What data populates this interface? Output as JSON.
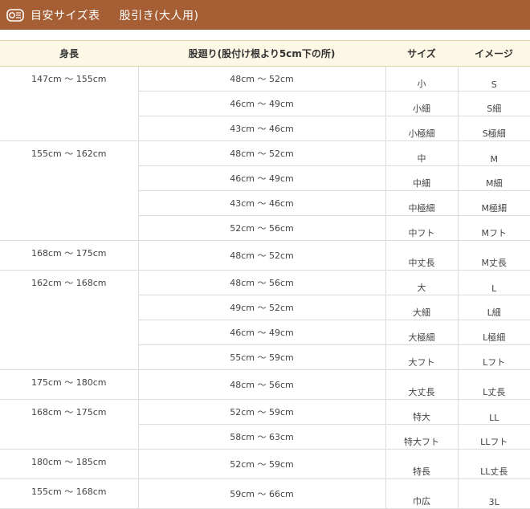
{
  "header": {
    "title": "目安サイズ表",
    "subtitle": "股引き(大人用)",
    "icon": "tape-measure-icon",
    "bg_color": "#a65e35"
  },
  "table": {
    "headers": [
      "身長",
      "股廻り(股付け根より5cm下の所)",
      "サイズ",
      "イメージ"
    ],
    "groups": [
      {
        "height": "147cm 〜 155cm",
        "rows": [
          {
            "waist": "48cm 〜 52cm",
            "size": "小",
            "image": "S"
          },
          {
            "waist": "46cm 〜 49cm",
            "size": "小細",
            "image": "S細"
          },
          {
            "waist": "43cm 〜 46cm",
            "size": "小極細",
            "image": "S極細"
          }
        ]
      },
      {
        "height": "155cm 〜 162cm",
        "rows": [
          {
            "waist": "48cm 〜 52cm",
            "size": "中",
            "image": "M"
          },
          {
            "waist": "46cm 〜 49cm",
            "size": "中細",
            "image": "M細"
          },
          {
            "waist": "43cm 〜 46cm",
            "size": "中極細",
            "image": "M極細"
          },
          {
            "waist": "52cm 〜 56cm",
            "size": "中フト",
            "image": "Mフト"
          }
        ]
      },
      {
        "height": "168cm 〜 175cm",
        "rows": [
          {
            "waist": "48cm 〜 52cm",
            "size": "中丈長",
            "image": "M丈長"
          }
        ]
      },
      {
        "height": "162cm 〜 168cm",
        "rows": [
          {
            "waist": "48cm 〜 56cm",
            "size": "大",
            "image": "L"
          },
          {
            "waist": "49cm 〜 52cm",
            "size": "大細",
            "image": "L細"
          },
          {
            "waist": "46cm 〜 49cm",
            "size": "大極細",
            "image": "L極細"
          },
          {
            "waist": "55cm 〜 59cm",
            "size": "大フト",
            "image": "Lフト"
          }
        ]
      },
      {
        "height": "175cm 〜 180cm",
        "rows": [
          {
            "waist": "48cm 〜 56cm",
            "size": "大丈長",
            "image": "L丈長"
          }
        ]
      },
      {
        "height": "168cm 〜 175cm",
        "rows": [
          {
            "waist": "52cm 〜 59cm",
            "size": "特大",
            "image": "LL"
          },
          {
            "waist": "58cm 〜 63cm",
            "size": "特大フト",
            "image": "LLフト"
          }
        ]
      },
      {
        "height": "180cm 〜 185cm",
        "rows": [
          {
            "waist": "52cm 〜 59cm",
            "size": "特長",
            "image": "LL丈長"
          }
        ]
      },
      {
        "height": "155cm 〜 168cm",
        "rows": [
          {
            "waist": "59cm 〜 66cm",
            "size": "巾広",
            "image": "3L"
          }
        ]
      }
    ]
  }
}
